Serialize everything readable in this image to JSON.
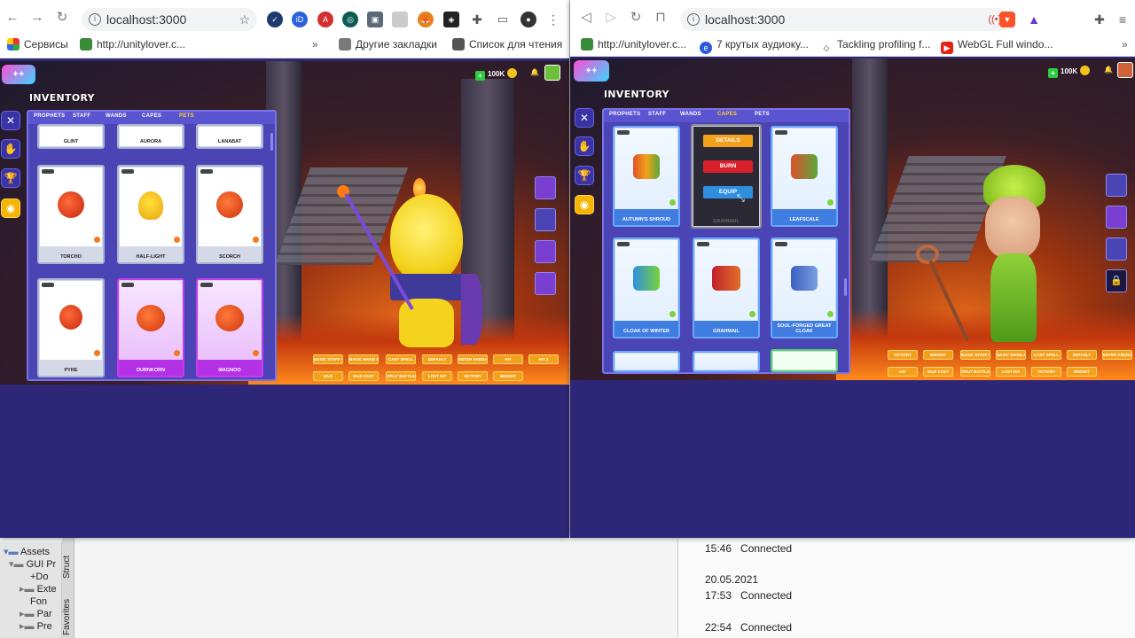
{
  "left_browser": {
    "url": "localhost:3000",
    "bookmarks": [
      "Сервисы",
      "http://unitylover.c...",
      "Другие закладки",
      "Список для чтения"
    ],
    "game": {
      "title": "INVENTORY",
      "tabs": [
        "PROPHETS",
        "STAFF",
        "WANDS",
        "CAPES",
        "PETS"
      ],
      "active_tab": "PETS",
      "hud": {
        "currency": "100K"
      },
      "top_row": [
        "GLINT",
        "AURORA",
        "LANABAT"
      ],
      "cards": [
        {
          "name": "TORCHO",
          "style": "normal"
        },
        {
          "name": "HALF-LIGHT",
          "style": "normal"
        },
        {
          "name": "SCORCH",
          "style": "normal"
        },
        {
          "name": "PYRE",
          "style": "normal"
        },
        {
          "name": "DURNKORN",
          "style": "purple"
        },
        {
          "name": "MAGNOO",
          "style": "purple"
        }
      ],
      "anim_buttons_row1": [
        "BASIC STAFF ATTACK",
        "BASIC WAND ATTACK",
        "CAST SPELL",
        "DEFAULT",
        "ENTER ARENA POSTER",
        "HIT",
        "HIT 2"
      ],
      "anim_buttons_row2": [
        "IDLE",
        "IDLE CAST",
        "SPLIT BATTLE",
        "LOST HIT",
        "VICTORY",
        "WEIGHT"
      ]
    }
  },
  "right_browser": {
    "url": "localhost:3000",
    "bookmarks": [
      "http://unitylover.c...",
      "7 крутых аудиоку...",
      "Tackling profiling f...",
      "WebGL Full windo..."
    ],
    "game": {
      "title": "INVENTORY",
      "tabs": [
        "PROPHETS",
        "STAFF",
        "WANDS",
        "CAPES",
        "PETS"
      ],
      "active_tab": "CAPES",
      "hud": {
        "currency": "100K"
      },
      "actions": {
        "details": "DETAILS",
        "burn": "BURN",
        "equip": "EQUIP"
      },
      "selected_card_caption": "GRAHMAIL",
      "cards": [
        {
          "name": "AUTUMN'S SHROUD",
          "style": "blue"
        },
        {
          "name": "",
          "style": "dark"
        },
        {
          "name": "LEAFSCALE",
          "style": "blue"
        },
        {
          "name": "CLOAK OF WINTER",
          "style": "blue"
        },
        {
          "name": "GRAHMAIL",
          "style": "blue"
        },
        {
          "name": "SOUL-FORGED GREAT CLOAK",
          "style": "blue"
        }
      ],
      "anim_buttons_row1": [
        "VICTORY",
        "WEIGHT",
        "BASIC STAFF ATTACK",
        "BASIC WAND ATTACK",
        "CAST SPELL",
        "DEFAULT",
        "ENTER ARENA POSTER"
      ],
      "anim_buttons_row2": [
        "HIT",
        "IDLE CAST",
        "SPLIT BATTLE",
        "LOST HIT",
        "VICTORY",
        "WEIGHT"
      ]
    }
  },
  "editor": {
    "assets_tree": [
      "Assets",
      "GUI Pr",
      "+Do",
      "Exte",
      "Fon",
      "Par",
      "Pre"
    ],
    "side_tabs": [
      "Struct",
      "Favorites"
    ],
    "console": [
      {
        "time": "15:46",
        "text": "Connected"
      },
      {
        "date": "20.05.2021"
      },
      {
        "time": "17:53",
        "text": "Connected"
      },
      {
        "time": "22:54",
        "text": "Connected"
      }
    ]
  }
}
